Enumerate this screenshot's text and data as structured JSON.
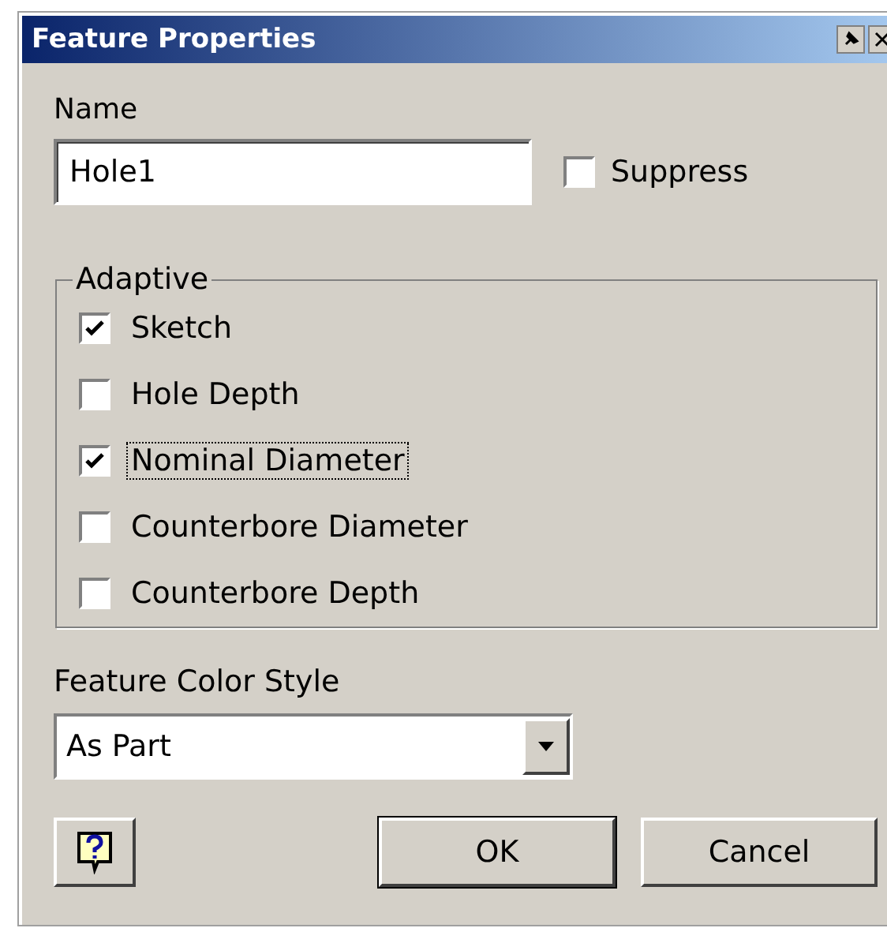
{
  "window": {
    "title": "Feature Properties"
  },
  "name": {
    "label": "Name",
    "value": "Hole1"
  },
  "suppress": {
    "label": "Suppress",
    "checked": false
  },
  "adaptive": {
    "title": "Adaptive",
    "items": [
      {
        "label": "Sketch",
        "checked": true,
        "focused": false
      },
      {
        "label": "Hole Depth",
        "checked": false,
        "focused": false
      },
      {
        "label": "Nominal Diameter",
        "checked": true,
        "focused": true
      },
      {
        "label": "Counterbore Diameter",
        "checked": false,
        "focused": false
      },
      {
        "label": "Counterbore Depth",
        "checked": false,
        "focused": false
      }
    ]
  },
  "color_style": {
    "label": "Feature Color Style",
    "value": "As Part"
  },
  "buttons": [
    {
      "kind": "help"
    },
    {
      "kind": "text",
      "label": "OK",
      "default": true
    },
    {
      "kind": "text",
      "label": "Cancel",
      "default": false
    }
  ]
}
